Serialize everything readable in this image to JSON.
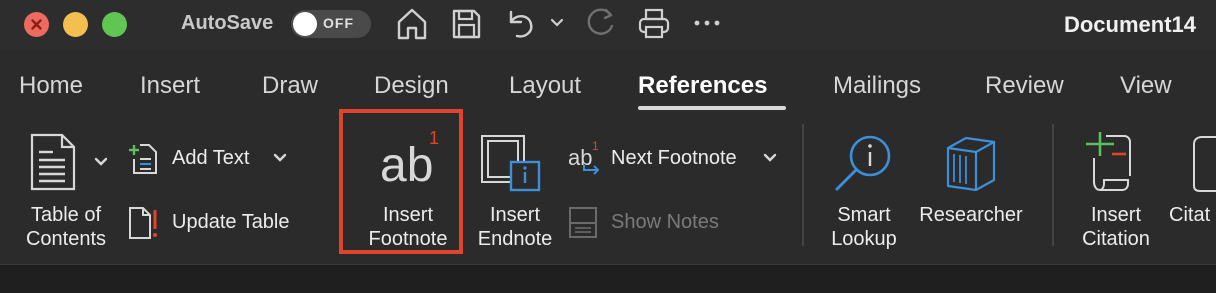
{
  "titlebar": {
    "autosave_label": "AutoSave",
    "autosave_state": "OFF",
    "document_title": "Document14",
    "quick_icons": [
      "home-icon",
      "save-icon",
      "undo-icon",
      "chevron-down-icon",
      "redo-icon",
      "print-icon",
      "more-icon"
    ]
  },
  "tabs": [
    {
      "label": "Home"
    },
    {
      "label": "Insert"
    },
    {
      "label": "Draw"
    },
    {
      "label": "Design"
    },
    {
      "label": "Layout"
    },
    {
      "label": "References",
      "active": true
    },
    {
      "label": "Mailings"
    },
    {
      "label": "Review"
    },
    {
      "label": "View"
    }
  ],
  "ribbon": {
    "toc": {
      "line1": "Table of",
      "line2": "Contents"
    },
    "add_text": "Add Text",
    "update_table": "Update Table",
    "insert_footnote": {
      "line1": "Insert",
      "line2": "Footnote",
      "icon_text": "ab",
      "superscript": "1"
    },
    "insert_endnote": {
      "line1": "Insert",
      "line2": "Endnote"
    },
    "next_footnote": {
      "label": "Next Footnote",
      "icon_text": "ab",
      "superscript": "1"
    },
    "show_notes": "Show Notes",
    "smart_lookup": {
      "line1": "Smart",
      "line2": "Lookup"
    },
    "researcher": "Researcher",
    "insert_citation": {
      "line1": "Insert",
      "line2": "Citation"
    },
    "citations_partial": "Citat"
  },
  "colors": {
    "highlight": "#e0442d",
    "accent_blue": "#3c8fd8",
    "accent_green": "#5cc15a",
    "accent_red": "#e0442d"
  }
}
